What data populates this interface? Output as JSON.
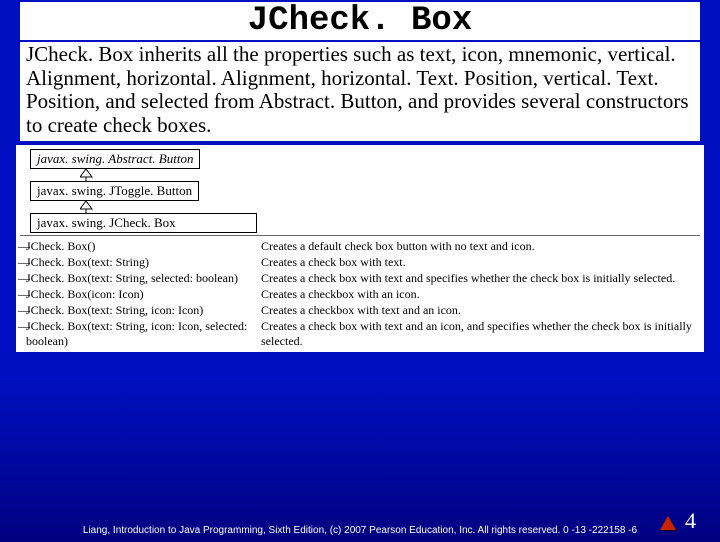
{
  "title": "JCheck. Box",
  "body": "JCheck. Box inherits all the properties such as text, icon, mnemonic, vertical. Alignment, horizontal. Alignment, horizontal. Text. Position, vertical. Text. Position, and selected from Abstract. Button, and provides several constructors to create check boxes.",
  "hierarchy": {
    "c0": "javax. swing. Abstract. Button",
    "c1": "javax. swing. JToggle. Button",
    "c2": "javax. swing. JCheck. Box"
  },
  "methods": [
    {
      "sig": "JCheck. Box()",
      "desc": "Creates a default check box button with no text and icon."
    },
    {
      "sig": "JCheck. Box(text: String)",
      "desc": "Creates a check box with text."
    },
    {
      "sig": "JCheck. Box(text: String, selected: boolean)",
      "desc": "Creates a check box with text and specifies whether the check box is initially selected."
    },
    {
      "sig": "JCheck. Box(icon: Icon)",
      "desc": "Creates a checkbox with an icon."
    },
    {
      "sig": "JCheck. Box(text: String, icon: Icon)",
      "desc": "Creates a checkbox with text and an icon."
    },
    {
      "sig": "JCheck. Box(text: String, icon: Icon, selected: boolean)",
      "desc": "Creates a check box with text and an icon, and specifies whether the check box is initially selected."
    }
  ],
  "footer": "Liang, Introduction to Java Programming, Sixth Edition, (c) 2007 Pearson Education, Inc. All rights reserved. 0 -13 -222158 -6",
  "page": "4"
}
